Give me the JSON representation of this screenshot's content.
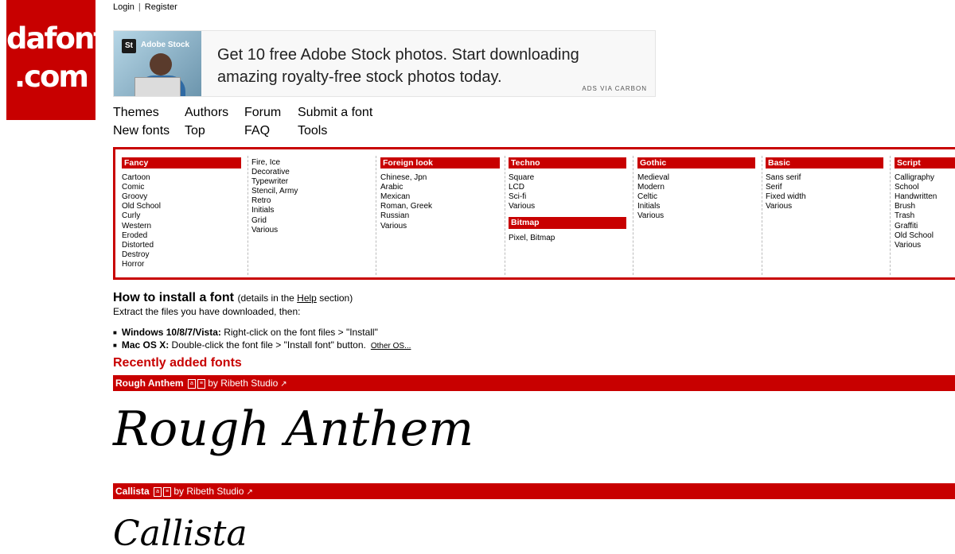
{
  "top_links": {
    "login": "Login",
    "separator": "|",
    "register": "Register"
  },
  "logo": {
    "line1": "dafont",
    "line2": ".com"
  },
  "ad": {
    "brand": "Adobe Stock",
    "brand_badge": "St",
    "text": "Get 10 free Adobe Stock photos. Start downloading amazing royalty-free stock photos today.",
    "via": "ADS VIA CARBON"
  },
  "nav": {
    "themes": "Themes",
    "authors": "Authors",
    "forum": "Forum",
    "submit": "Submit a font",
    "new_fonts": "New fonts",
    "top": "Top",
    "faq": "FAQ",
    "tools": "Tools"
  },
  "categories": {
    "fancy": {
      "title": "Fancy",
      "items": [
        "Cartoon",
        "Comic",
        "Groovy",
        "Old School",
        "Curly",
        "Western",
        "Eroded",
        "Distorted",
        "Destroy",
        "Horror"
      ]
    },
    "fancy2": {
      "items": [
        "Fire, Ice",
        "Decorative",
        "Typewriter",
        "Stencil, Army",
        "Retro",
        "Initials",
        "Grid",
        "Various"
      ]
    },
    "foreign": {
      "title": "Foreign look",
      "items": [
        "Chinese, Jpn",
        "Arabic",
        "Mexican",
        "Roman, Greek",
        "Russian",
        "Various"
      ]
    },
    "techno": {
      "title": "Techno",
      "items": [
        "Square",
        "LCD",
        "Sci-fi",
        "Various"
      ]
    },
    "bitmap": {
      "title": "Bitmap",
      "items": [
        "Pixel, Bitmap"
      ]
    },
    "gothic": {
      "title": "Gothic",
      "items": [
        "Medieval",
        "Modern",
        "Celtic",
        "Initials",
        "Various"
      ]
    },
    "basic": {
      "title": "Basic",
      "items": [
        "Sans serif",
        "Serif",
        "Fixed width",
        "Various"
      ]
    },
    "script": {
      "title": "Script",
      "items": [
        "Calligraphy",
        "School",
        "Handwritten",
        "Brush",
        "Trash",
        "Graffiti",
        "Old School",
        "Various"
      ]
    }
  },
  "howto": {
    "title": "How to install a font",
    "details_pre": "(details in the ",
    "details_link": "Help",
    "details_post": " section)",
    "extract": "Extract the files you have downloaded, then:",
    "windows_label": "Windows 10/8/7/Vista:",
    "windows_text": " Right-click on the font files > \"Install\"",
    "mac_label": "Mac OS X:",
    "mac_text": " Double-click the font file > \"Install font\" button.",
    "other": "Other OS..."
  },
  "recent": {
    "title": "Recently added fonts"
  },
  "fonts": [
    {
      "name": "Rough Anthem",
      "by": "by Ribeth Studio",
      "preview": "Rough Anthem"
    },
    {
      "name": "Callista",
      "by": "by Ribeth Studio",
      "preview": "Callista"
    }
  ],
  "colors": {
    "accent": "#c80000"
  }
}
